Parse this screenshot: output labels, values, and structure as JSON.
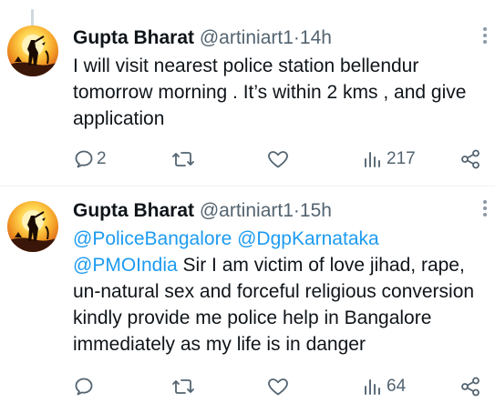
{
  "tweets": [
    {
      "author_name": "Gupta Bharat",
      "handle": "@artiniart1",
      "separator": "·",
      "time": "14h",
      "text": "I will visit nearest police station bellendur tomorrow morning . It’s within 2 kms , and give application",
      "mentions": [],
      "replies": "2",
      "retweets": "",
      "likes": "",
      "views": "217"
    },
    {
      "author_name": "Gupta Bharat",
      "handle": "@artiniart1",
      "separator": "·",
      "time": "15h",
      "mentions": [
        "@PoliceBangalore",
        "@DgpKarnataka",
        "@PMOIndia"
      ],
      "text": "Sir I am victim of love jihad, rape, un-natural sex and forceful religious conversion kindly provide me police help in Bangalore immediately as my life is in danger",
      "replies": "",
      "retweets": "",
      "likes": "",
      "views": "64"
    }
  ],
  "icons": {
    "reply": "reply-icon",
    "retweet": "retweet-icon",
    "like": "heart-icon",
    "views": "views-icon",
    "share": "share-icon",
    "more": "more-icon"
  },
  "colors": {
    "mention": "#1d9bf0",
    "secondary_text": "#536471",
    "divider": "#eff3f4"
  }
}
